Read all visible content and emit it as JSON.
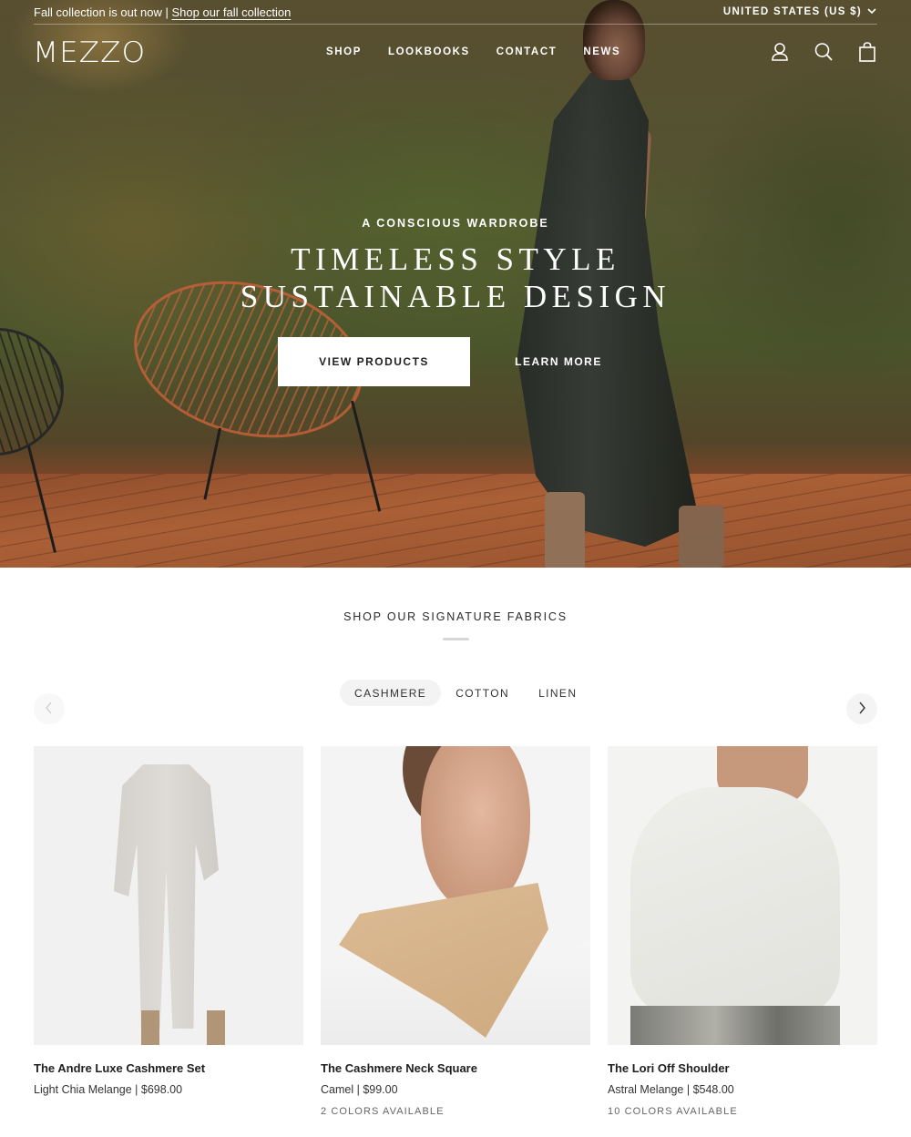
{
  "announcement": {
    "text": "Fall collection is out now | ",
    "link_label": "Shop our fall collection"
  },
  "locale": {
    "country_label": "UNITED STATES (US $)"
  },
  "header": {
    "logo": "MEZZO",
    "nav": [
      "SHOP",
      "LOOKBOOKS",
      "CONTACT",
      "NEWS"
    ],
    "icons": [
      "account-icon",
      "search-icon",
      "cart-icon"
    ]
  },
  "hero": {
    "eyebrow": "A CONSCIOUS WARDROBE",
    "headline_line1": "TIMELESS STYLE",
    "headline_line2": "SUSTAINABLE DESIGN",
    "primary_button": "VIEW PRODUCTS",
    "secondary_button": "LEARN MORE"
  },
  "fabrics": {
    "title": "SHOP OUR SIGNATURE FABRICS",
    "tabs": [
      {
        "label": "CASHMERE",
        "active": true
      },
      {
        "label": "COTTON",
        "active": false
      },
      {
        "label": "LINEN",
        "active": false
      }
    ],
    "products": [
      {
        "name": "The Andre Luxe Cashmere Set",
        "meta": "Light Chia Melange | $698.00",
        "colors": ""
      },
      {
        "name": "The Cashmere Neck Square",
        "meta": "Camel | $99.00",
        "colors": "2 COLORS AVAILABLE"
      },
      {
        "name": "The Lori Off Shoulder",
        "meta": "Astral Melange | $548.00",
        "colors": "10 COLORS AVAILABLE"
      }
    ]
  }
}
